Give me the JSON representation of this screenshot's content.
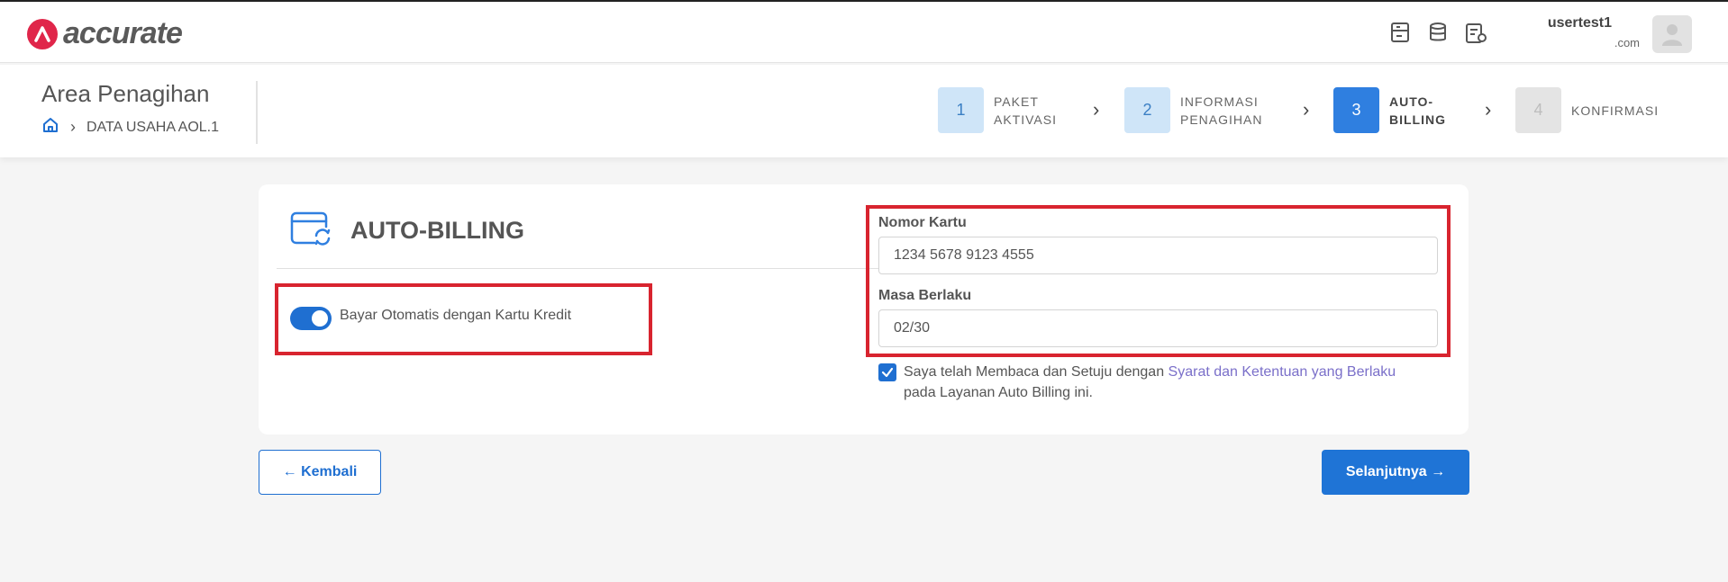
{
  "app": {
    "logo_text": "accurate",
    "user_name": "usertest1",
    "user_email": ".com"
  },
  "header": {
    "title": "Area Penagihan",
    "breadcrumb": "DATA USAHA AOL.1"
  },
  "steps": [
    {
      "num": "1",
      "line1": "PAKET",
      "line2": "AKTIVASI",
      "state": "done"
    },
    {
      "num": "2",
      "line1": "INFORMASI",
      "line2": "PENAGIHAN",
      "state": "done"
    },
    {
      "num": "3",
      "line1": "AUTO-",
      "line2": "BILLING",
      "state": "active"
    },
    {
      "num": "4",
      "line1": "KONFIRMASI",
      "line2": "",
      "state": "pending"
    }
  ],
  "card": {
    "title": "AUTO-BILLING",
    "toggle_label": "Bayar Otomatis dengan Kartu Kredit",
    "toggle_on": true,
    "card_number_label": "Nomor Kartu",
    "card_number_value": "1234 5678 9123 4555",
    "expiry_label": "Masa Berlaku",
    "expiry_value": "02/30",
    "agree_prefix": "Saya telah Membaca dan Setuju dengan ",
    "agree_link": "Syarat dan Ketentuan yang Berlaku",
    "agree_suffix": " pada Layanan Auto Billing ini.",
    "agree_checked": true
  },
  "buttons": {
    "back": "← Kembali",
    "next": "Selanjutnya →"
  },
  "colors": {
    "primary": "#1f6fd1",
    "highlight": "#d8242f",
    "brand": "#e0264a"
  }
}
